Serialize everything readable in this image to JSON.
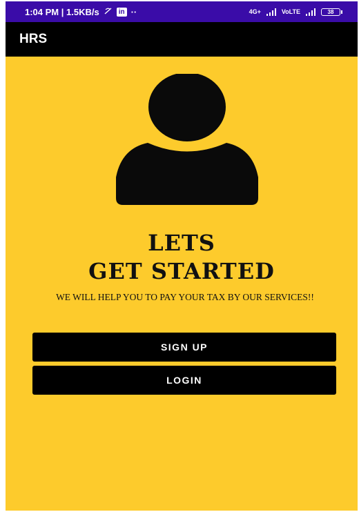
{
  "status_bar": {
    "time_info": "1:04 PM | 1.5KB/s",
    "notification_badge": "in",
    "more_indicator": "··",
    "net_label_1": "4G+",
    "net_label_2": "VoLTE",
    "battery_level": "38",
    "background_color": "#3A0CA8"
  },
  "app_bar": {
    "title": "HRS"
  },
  "hero": {
    "headline_line1": "LETS",
    "headline_line2": "GET STARTED",
    "tagline": "WE WILL HELP YOU TO PAY YOUR TAX BY OUR SERVICES!!"
  },
  "actions": {
    "signup_label": "SIGN UP",
    "login_label": "LOGIN"
  },
  "colors": {
    "background": "#FDCB2C",
    "accent": "#000000"
  },
  "icons": {
    "avatar": "user-silhouette-icon"
  }
}
